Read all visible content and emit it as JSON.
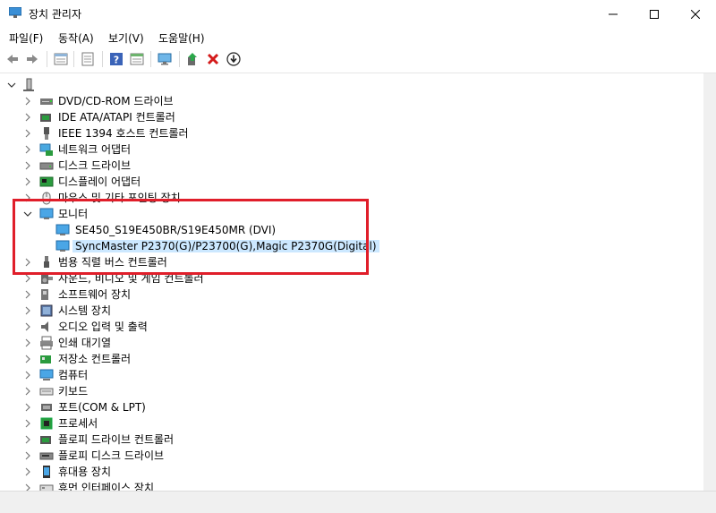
{
  "window": {
    "title": "장치 관리자"
  },
  "menu": [
    "파일(F)",
    "동작(A)",
    "보기(V)",
    "도움말(H)"
  ],
  "colors": {
    "highlight": "#e01e2a",
    "selection": "#cce8ff",
    "monitor": "#2b8fd6"
  },
  "toolbar": {
    "icons": [
      "back-icon",
      "forward-icon",
      "properties-icon",
      "show-hidden-icon",
      "help-icon",
      "details-icon",
      "monitor-scan-icon",
      "update-driver-icon",
      "uninstall-icon",
      "download-icon"
    ]
  },
  "tree": {
    "root_icon": "computer-icon",
    "items": [
      {
        "label": "DVD/CD-ROM 드라이브",
        "icon": "dvd-drive-icon",
        "expanded": false
      },
      {
        "label": "IDE ATA/ATAPI 컨트롤러",
        "icon": "ide-controller-icon",
        "expanded": false
      },
      {
        "label": "IEEE 1394 호스트 컨트롤러",
        "icon": "ieee1394-icon",
        "expanded": false
      },
      {
        "label": "네트워크 어댑터",
        "icon": "network-adapter-icon",
        "expanded": false
      },
      {
        "label": "디스크 드라이브",
        "icon": "disk-drive-icon",
        "expanded": false
      },
      {
        "label": "디스플레이 어댑터",
        "icon": "display-adapter-icon",
        "expanded": false
      },
      {
        "label": "마우스 및 기타 포인팅 장치",
        "icon": "mouse-icon",
        "expanded": false
      },
      {
        "label": "모니터",
        "icon": "monitor-icon",
        "expanded": true,
        "children": [
          {
            "label": "SE450_S19E450BR/S19E450MR (DVI)",
            "icon": "monitor-icon"
          },
          {
            "label": "SyncMaster P2370(G)/P23700(G),Magic P2370G(Digital)",
            "icon": "monitor-icon",
            "selected": true
          }
        ]
      },
      {
        "label": "범용 직렬 버스 컨트롤러",
        "icon": "usb-icon",
        "expanded": false
      },
      {
        "label": "사운드, 비디오 및 게임 컨트롤러",
        "icon": "sound-icon",
        "expanded": false
      },
      {
        "label": "소프트웨어 장치",
        "icon": "software-device-icon",
        "expanded": false
      },
      {
        "label": "시스템 장치",
        "icon": "system-device-icon",
        "expanded": false
      },
      {
        "label": "오디오 입력 및 출력",
        "icon": "audio-icon",
        "expanded": false
      },
      {
        "label": "인쇄 대기열",
        "icon": "printer-icon",
        "expanded": false
      },
      {
        "label": "저장소 컨트롤러",
        "icon": "storage-controller-icon",
        "expanded": false
      },
      {
        "label": "컴퓨터",
        "icon": "computer-icon",
        "expanded": false
      },
      {
        "label": "키보드",
        "icon": "keyboard-icon",
        "expanded": false
      },
      {
        "label": "포트(COM & LPT)",
        "icon": "port-icon",
        "expanded": false
      },
      {
        "label": "프로세서",
        "icon": "processor-icon",
        "expanded": false
      },
      {
        "label": "플로피 드라이브 컨트롤러",
        "icon": "floppy-controller-icon",
        "expanded": false
      },
      {
        "label": "플로피 디스크 드라이브",
        "icon": "floppy-drive-icon",
        "expanded": false
      },
      {
        "label": "휴대용 장치",
        "icon": "portable-device-icon",
        "expanded": false
      },
      {
        "label": "휴먼 인터페이스 장치",
        "icon": "hid-icon",
        "expanded": false
      }
    ]
  }
}
